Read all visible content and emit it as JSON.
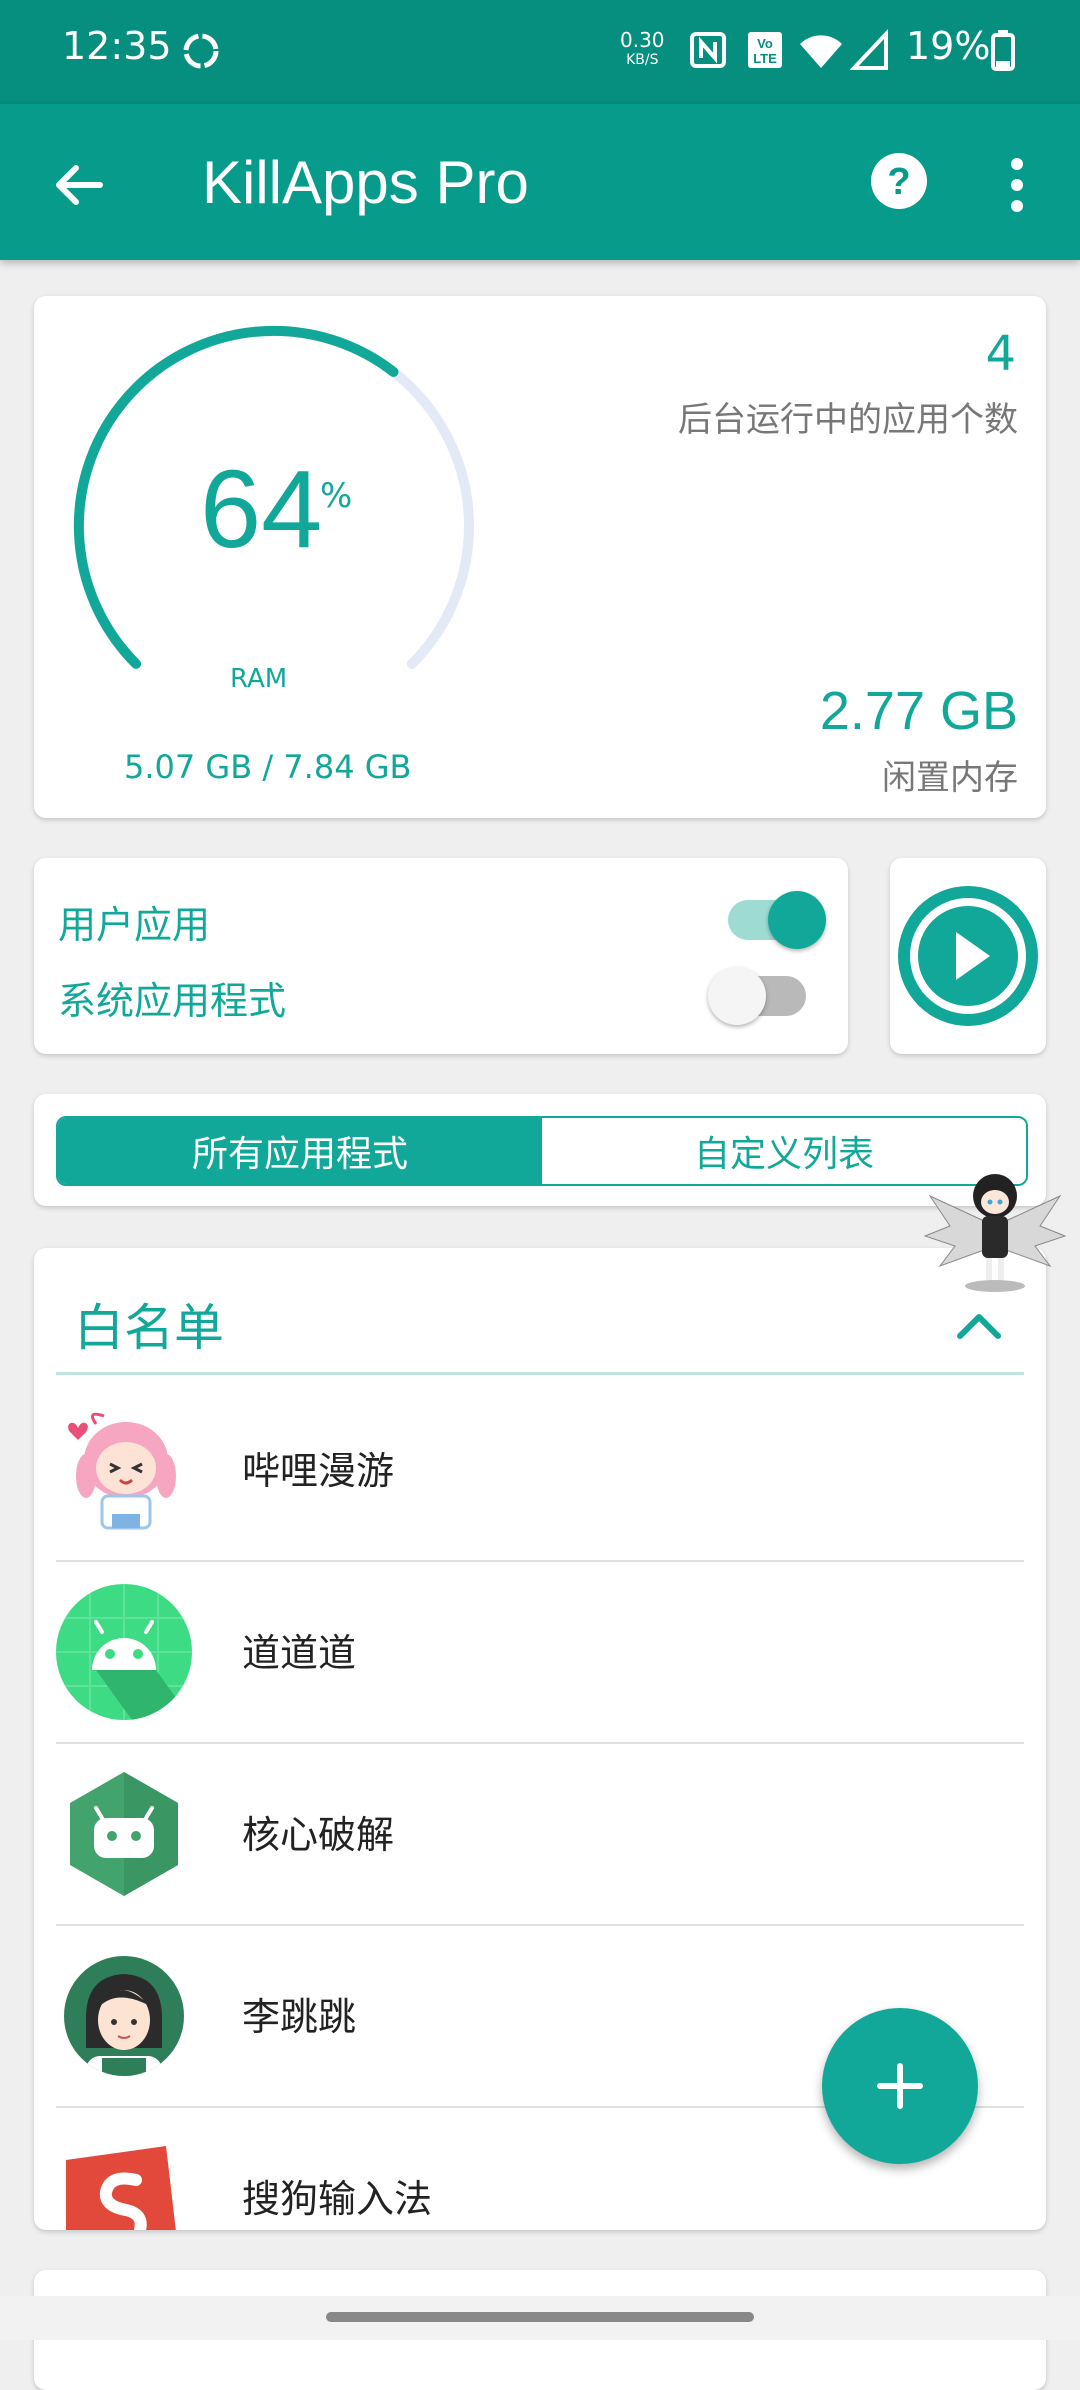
{
  "status_bar": {
    "time": "12:35",
    "net_speed": "0.30",
    "net_unit": "KB/S",
    "battery": "19%",
    "icons": [
      "sync-icon",
      "nfc-icon",
      "volte-icon",
      "wifi-icon",
      "signal-icon",
      "battery-icon"
    ]
  },
  "app_bar": {
    "title": "KillApps Pro",
    "icons": [
      "back-arrow-icon",
      "help-icon",
      "more-vert-icon"
    ]
  },
  "ram": {
    "percent": "64",
    "percent_sign": "%",
    "label": "RAM",
    "used": "5.07 GB / 7.84 GB",
    "background_count": "4",
    "background_label": "后台运行中的应用个数",
    "free": "2.77 GB",
    "free_label": "闲置内存",
    "usage_fraction": 0.64
  },
  "filters": {
    "user_apps": {
      "label": "用户应用",
      "enabled": true
    },
    "system_apps": {
      "label": "系统应用程式",
      "enabled": false
    }
  },
  "tabs": [
    {
      "label": "所有应用程式",
      "active": true
    },
    {
      "label": "自定义列表",
      "active": false
    }
  ],
  "whitelist": {
    "title": "白名单",
    "items": [
      {
        "name": "哔哩漫游"
      },
      {
        "name": "道道道"
      },
      {
        "name": "核心破解"
      },
      {
        "name": "李跳跳"
      },
      {
        "name": "搜狗输入法"
      }
    ]
  },
  "colors": {
    "primary": "#069b8b",
    "primary_dark": "#068f7f",
    "accent": "#12a899"
  }
}
